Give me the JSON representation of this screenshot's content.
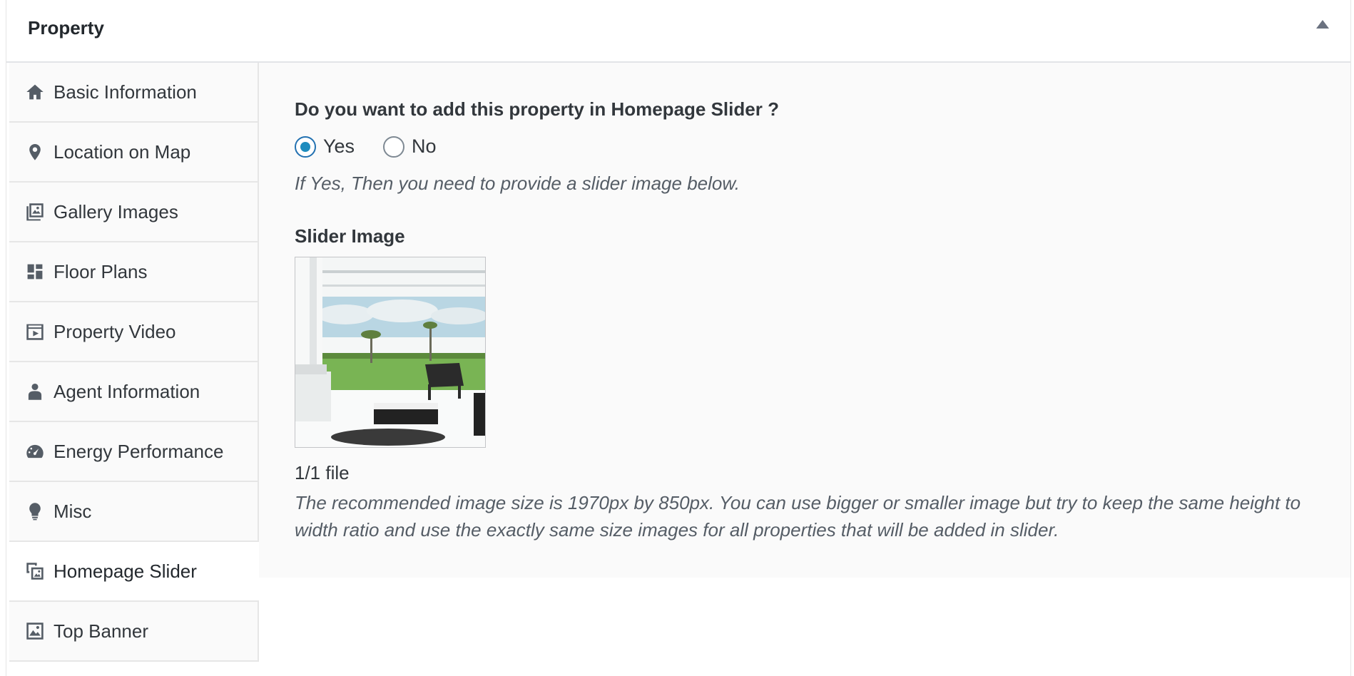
{
  "postbox": {
    "title": "Property"
  },
  "tabs": [
    {
      "label": "Basic Information",
      "icon": "home-icon"
    },
    {
      "label": "Location on Map",
      "icon": "location-pin-icon"
    },
    {
      "label": "Gallery Images",
      "icon": "gallery-icon"
    },
    {
      "label": "Floor Plans",
      "icon": "floor-plans-icon"
    },
    {
      "label": "Property Video",
      "icon": "video-icon"
    },
    {
      "label": "Agent Information",
      "icon": "person-icon"
    },
    {
      "label": "Energy Performance",
      "icon": "dashboard-icon"
    },
    {
      "label": "Misc",
      "icon": "lightbulb-icon"
    },
    {
      "label": "Homepage Slider",
      "icon": "images-icon",
      "active": true
    },
    {
      "label": "Top Banner",
      "icon": "image-icon"
    }
  ],
  "panel": {
    "question": "Do you want to add this property in Homepage Slider ?",
    "options": {
      "yes": "Yes",
      "no": "No",
      "selected": "Yes"
    },
    "hint": "If Yes, Then you need to provide a slider image below.",
    "slider_image_label": "Slider Image",
    "file_count": "1/1 file",
    "description": "The recommended image size is 1970px by 850px. You can use bigger or smaller image but try to keep the same height to width ratio and use the exactly same size images for all properties that will be added in slider."
  },
  "colors": {
    "radio_checked": "#1e8cbe",
    "panel_bg": "#fafafa"
  }
}
